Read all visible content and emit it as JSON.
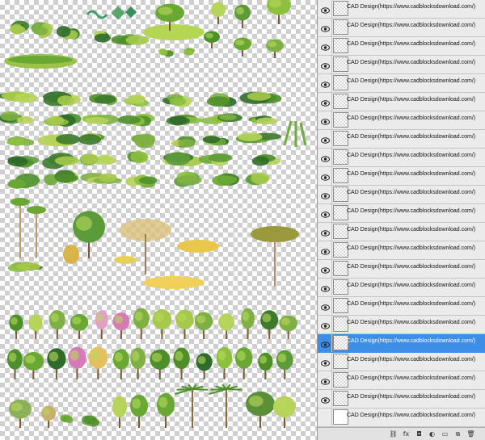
{
  "canvas": {
    "description_icon": "plant-sprite-sheet"
  },
  "layers_panel": {
    "layer_name": "CAD Design(https://www.cadblocksdownload.com/)",
    "layers": [
      {
        "name": "CAD Design(https://www.cadblocksdownload.com/)",
        "visible": true,
        "selected": false,
        "thumb": "checker"
      },
      {
        "name": "CAD Design(https://www.cadblocksdownload.com/)",
        "visible": true,
        "selected": false,
        "thumb": "checker"
      },
      {
        "name": "CAD Design(https://www.cadblocksdownload.com/)",
        "visible": true,
        "selected": false,
        "thumb": "checker"
      },
      {
        "name": "CAD Design(https://www.cadblocksdownload.com/)",
        "visible": true,
        "selected": false,
        "thumb": "checker"
      },
      {
        "name": "CAD Design(https://www.cadblocksdownload.com/)",
        "visible": true,
        "selected": false,
        "thumb": "checker"
      },
      {
        "name": "CAD Design(https://www.cadblocksdownload.com/)",
        "visible": true,
        "selected": false,
        "thumb": "checker"
      },
      {
        "name": "CAD Design(https://www.cadblocksdownload.com/)",
        "visible": true,
        "selected": false,
        "thumb": "checker"
      },
      {
        "name": "CAD Design(https://www.cadblocksdownload.com/)",
        "visible": true,
        "selected": false,
        "thumb": "checker"
      },
      {
        "name": "CAD Design(https://www.cadblocksdownload.com/)",
        "visible": true,
        "selected": false,
        "thumb": "checker"
      },
      {
        "name": "CAD Design(https://www.cadblocksdownload.com/)",
        "visible": true,
        "selected": false,
        "thumb": "checker"
      },
      {
        "name": "CAD Design(https://www.cadblocksdownload.com/)",
        "visible": true,
        "selected": false,
        "thumb": "checker"
      },
      {
        "name": "CAD Design(https://www.cadblocksdownload.com/)",
        "visible": true,
        "selected": false,
        "thumb": "checker"
      },
      {
        "name": "CAD Design(https://www.cadblocksdownload.com/)",
        "visible": true,
        "selected": false,
        "thumb": "checker"
      },
      {
        "name": "CAD Design(https://www.cadblocksdownload.com/)",
        "visible": true,
        "selected": false,
        "thumb": "checker"
      },
      {
        "name": "CAD Design(https://www.cadblocksdownload.com/)",
        "visible": true,
        "selected": false,
        "thumb": "checker"
      },
      {
        "name": "CAD Design(https://www.cadblocksdownload.com/)",
        "visible": true,
        "selected": false,
        "thumb": "checker"
      },
      {
        "name": "CAD Design(https://www.cadblocksdownload.com/)",
        "visible": true,
        "selected": false,
        "thumb": "checker"
      },
      {
        "name": "CAD Design(https://www.cadblocksdownload.com/)",
        "visible": true,
        "selected": false,
        "thumb": "checker"
      },
      {
        "name": "CAD Design(https://www.cadblocksdownload.com/)",
        "visible": true,
        "selected": true,
        "thumb": "checker"
      },
      {
        "name": "CAD Design(https://www.cadblocksdownload.com/)",
        "visible": true,
        "selected": false,
        "thumb": "checker"
      },
      {
        "name": "CAD Design(https://www.cadblocksdownload.com/)",
        "visible": true,
        "selected": false,
        "thumb": "checker"
      },
      {
        "name": "CAD Design(https://www.cadblocksdownload.com/)",
        "visible": true,
        "selected": false,
        "thumb": "checker"
      },
      {
        "name": "CAD Design(https://www.cadblocksdownload.com/)",
        "visible": false,
        "selected": false,
        "thumb": "white"
      }
    ],
    "footer_buttons": [
      {
        "icon": "link-layers-icon",
        "glyph": "⛓"
      },
      {
        "icon": "fx-icon",
        "glyph": "fx"
      },
      {
        "icon": "layer-mask-icon",
        "glyph": "◘"
      },
      {
        "icon": "adjustment-layer-icon",
        "glyph": "◐"
      },
      {
        "icon": "new-group-icon",
        "glyph": "▭"
      },
      {
        "icon": "new-layer-icon",
        "glyph": "⧉"
      },
      {
        "icon": "trash-icon",
        "glyph": "🗑"
      }
    ]
  },
  "colors": {
    "selection": "#3d8ee6",
    "panel_bg": "#e8e8e8"
  }
}
